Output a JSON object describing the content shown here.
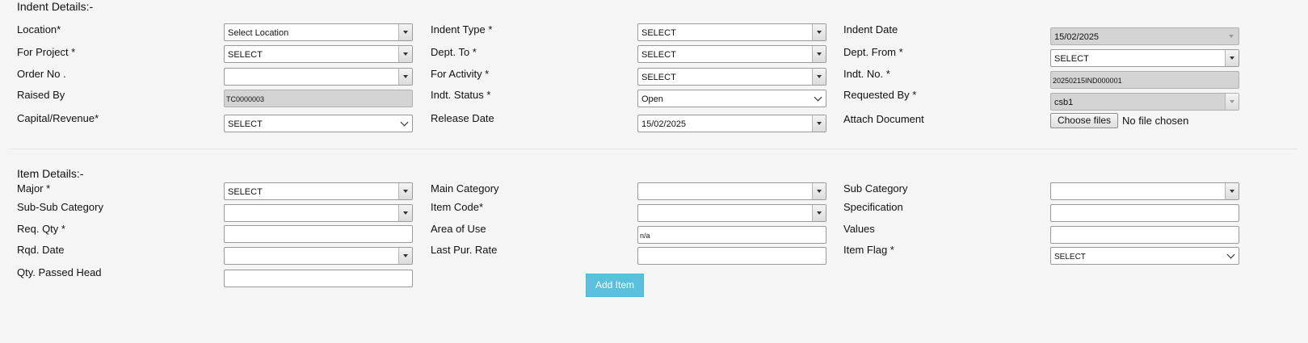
{
  "indent": {
    "section_title": "Indent Details:-",
    "location": {
      "label": "Location*",
      "value": "Select Location"
    },
    "indent_type": {
      "label": "Indent Type *",
      "value": "SELECT"
    },
    "indent_date": {
      "label": "Indent Date",
      "value": "15/02/2025"
    },
    "for_project": {
      "label": "For Project *",
      "value": "SELECT"
    },
    "dept_to": {
      "label": "Dept. To *",
      "value": "SELECT"
    },
    "dept_from": {
      "label": "Dept. From *",
      "value": "SELECT"
    },
    "order_no": {
      "label": "Order No .",
      "value": ""
    },
    "for_activity": {
      "label": "For Activity *",
      "value": "SELECT"
    },
    "indt_no": {
      "label": "Indt. No. *",
      "value": "20250215IND000001"
    },
    "raised_by": {
      "label": "Raised By",
      "value": "TC0000003"
    },
    "indt_status": {
      "label": "Indt. Status *",
      "value": "Open"
    },
    "requested_by": {
      "label": "Requested By *",
      "value": "csb1"
    },
    "capital_revenue": {
      "label": "Capital/Revenue*",
      "value": "SELECT"
    },
    "release_date": {
      "label": "Release Date",
      "value": "15/02/2025"
    },
    "attach_document": {
      "label": "Attach Document",
      "button": "Choose files",
      "status": "No file chosen"
    }
  },
  "item": {
    "section_title": "Item Details:-",
    "major": {
      "label": "Major *",
      "value": "SELECT"
    },
    "main_category": {
      "label": "Main Category",
      "value": ""
    },
    "sub_category": {
      "label": "Sub Category",
      "value": ""
    },
    "sub_sub_category": {
      "label": "Sub-Sub Category",
      "value": ""
    },
    "item_code": {
      "label": "Item Code*",
      "value": ""
    },
    "specification": {
      "label": "Specification",
      "value": ""
    },
    "req_qty": {
      "label": "Req. Qty *",
      "value": ""
    },
    "area_of_use": {
      "label": "Area of Use",
      "value": "n/a"
    },
    "values": {
      "label": "Values",
      "value": ""
    },
    "rqd_date": {
      "label": "Rqd. Date",
      "value": ""
    },
    "last_pur_rate": {
      "label": "Last Pur. Rate",
      "value": ""
    },
    "item_flag": {
      "label": "Item Flag *",
      "value": "SELECT"
    },
    "qty_passed_head": {
      "label": "Qty. Passed Head",
      "value": ""
    },
    "add_item_label": "Add Item"
  },
  "colors": {
    "add_button": "#5bc0de",
    "readonly_field": "#d4d4d4",
    "background": "#f5f5f5"
  }
}
